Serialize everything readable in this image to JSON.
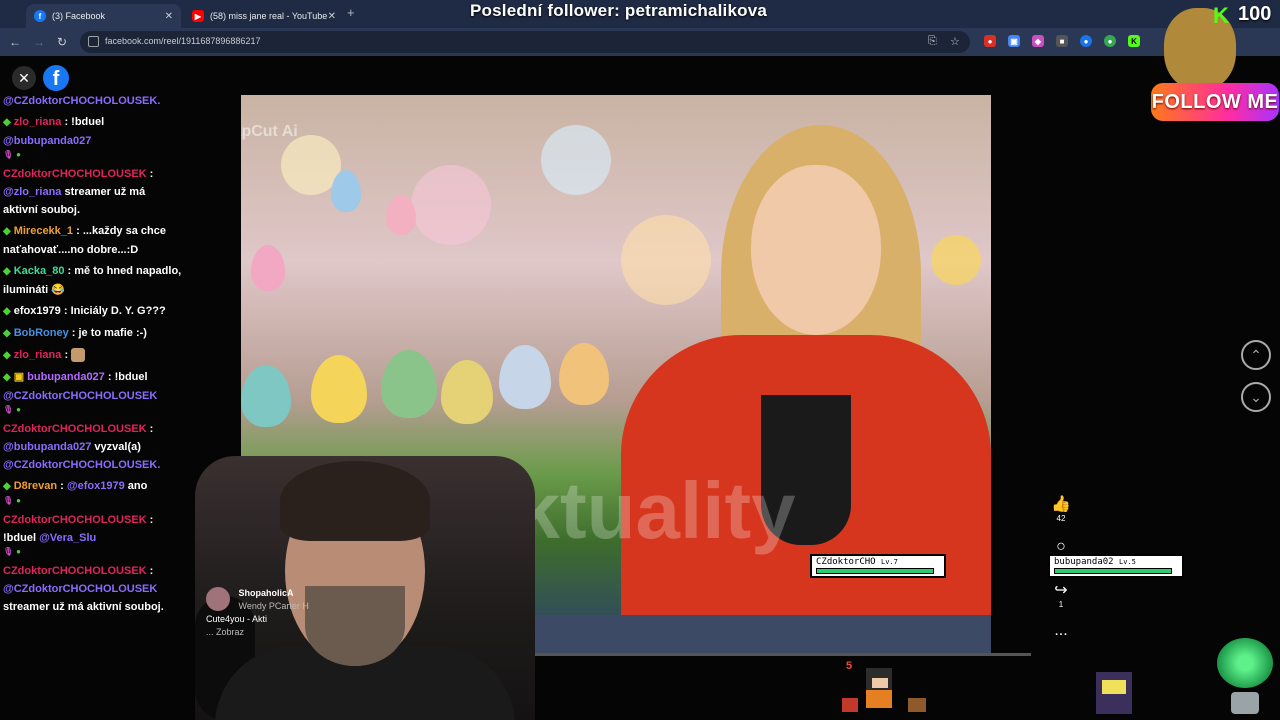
{
  "browser": {
    "tabs": [
      {
        "label": "(3) Facebook",
        "icon": "facebook-icon",
        "active": true
      },
      {
        "label": "(58) miss jane real - YouTube",
        "icon": "youtube-icon",
        "active": false
      }
    ],
    "new_tab": "+",
    "url": "facebook.com/reel/1911687896886217"
  },
  "stream_overlay": {
    "title": "Poslední follower: petramichalikova",
    "kick_count": "100",
    "follow_label": "FOLLOW ME"
  },
  "chat": {
    "messages": [
      {
        "user": "",
        "user_color": "#ffffff",
        "text": "@CZdoktorCHOCHOLOUSEK.",
        "mention": true
      },
      {
        "user": "zlo_riana",
        "user_color": "#e0245e",
        "text": "!bduel",
        "mention_after": "@bubupanda027",
        "badges": true
      },
      {
        "user": "CZdoktorCHOCHOLOUSEK",
        "user_color": "#e0245e",
        "mention_after": "@zlo_riana",
        "text": "streamer už má aktivní souboj."
      },
      {
        "user": "Mirecekk_1",
        "user_color": "#f0a030",
        "text": "...každy sa chce naťahovať....no dobre...:D"
      },
      {
        "user": "Kacka_80",
        "user_color": "#3ddc97",
        "text": "mě to hned napadlo, ilumináti 😂"
      },
      {
        "user": "efox1979",
        "user_color": "#ffffff",
        "text": "Iniciály D. Y. G???"
      },
      {
        "user": "BobRoney",
        "user_color": "#4a90e2",
        "text": "je to mafie :-)"
      },
      {
        "user": "zlo_riana",
        "user_color": "#e0245e",
        "text": "",
        "emote": true
      },
      {
        "user": "bubupanda027",
        "user_color": "#b36bff",
        "text": "!bduel",
        "mention_after": "@CZdoktorCHOCHOLOUSEK",
        "badges": true
      },
      {
        "user": "CZdoktorCHOCHOLOUSEK",
        "user_color": "#e0245e",
        "mention_after": "@bubupanda027",
        "text": "vyzval(a)",
        "mention_tail": "@CZdoktorCHOCHOLOUSEK."
      },
      {
        "user": "D8revan",
        "user_color": "#f0a030",
        "mention_after": "@efox1979",
        "text": "ano",
        "badges": true
      },
      {
        "user": "CZdoktorCHOCHOLOUSEK",
        "user_color": "#e0245e",
        "text": "!bduel",
        "mention_after": "@Vera_Slu",
        "badges": true
      },
      {
        "user": "CZdoktorCHOCHOLOUSEK",
        "user_color": "#e0245e",
        "mention_after": "@CZdoktorCHOCHOLOUSEK",
        "text": "streamer už má aktivní souboj."
      }
    ]
  },
  "video": {
    "watermark": "aktuality",
    "capcut": "CapCut Ai"
  },
  "comment_snippet": {
    "user": "ShopaholicA",
    "line2": "Wendy PCarter H",
    "line3": "Cute4you - Akti",
    "line4": "... Zobraz"
  },
  "actions": {
    "like_count": "42",
    "share_count": "1",
    "more": "..."
  },
  "hud": {
    "player1": {
      "name": "CZdoktorCHO",
      "level": "Lv.7",
      "hp_label": "HP",
      "hp": 0.95
    },
    "player2": {
      "name": "bubupanda02",
      "level": "Lv.5",
      "hp_label": "HP",
      "hp": 0.95
    },
    "damage": "5"
  }
}
